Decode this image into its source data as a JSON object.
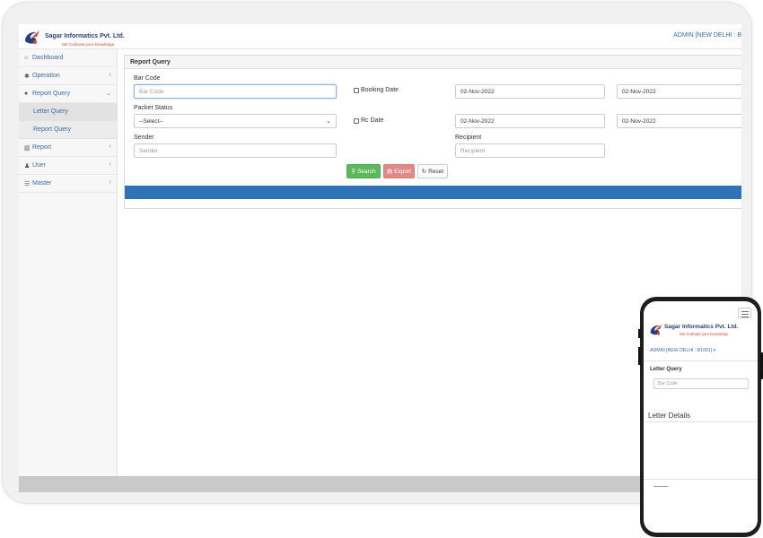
{
  "app": {
    "company_name": "Sagar Informatics Pvt. Ltd.",
    "tagline": "We Cultivate your knowledge",
    "user_label": "ADMIN [NEW DELHI : B"
  },
  "colors": {
    "primary_blue": "#2f72b6",
    "search_green": "#5cb85c",
    "export_red": "#e08a87",
    "link_blue": "#3b69a6",
    "logo_orange": "#e2452a"
  },
  "sidebar": {
    "items": [
      {
        "label": "Dashboard",
        "icon": "dashboard-icon"
      },
      {
        "label": "Operation",
        "icon": "gear-icon"
      },
      {
        "label": "Report Query",
        "icon": "question-circle-icon"
      },
      {
        "label": "Report",
        "icon": "bar-chart-icon"
      },
      {
        "label": "User",
        "icon": "user-icon"
      },
      {
        "label": "Master",
        "icon": "list-icon"
      }
    ],
    "subitems": [
      {
        "label": "Letter Query"
      },
      {
        "label": "Report Query"
      }
    ]
  },
  "form": {
    "title": "Report Query",
    "barcode_label": "Bar Code",
    "barcode_placeholder": "Bar Code",
    "packet_status_label": "Packet Status",
    "packet_status_selected": "--Select--",
    "booking_date_label": "Booking Date",
    "rc_date_label": "Rc Date",
    "booking_from": "02-Nov-2022",
    "booking_to": "02-Nov-2022",
    "rc_from": "02-Nov-2022",
    "rc_to": "02-Nov-2022",
    "sender_label": "Sender",
    "sender_placeholder": "Sender",
    "recipient_label": "Recipient",
    "recipient_placeholder": "Recipient",
    "search_label": "Search",
    "export_label": "Export",
    "reset_label": "Reset"
  },
  "phone": {
    "company_name": "Sagar Informatics Pvt. Ltd.",
    "tagline": "We Cultivate your knowledge",
    "user_label": "ADMIN [NEW DELHI : B1001] ▾",
    "section_title": "Letter Query",
    "barcode_placeholder": "Bar Code",
    "details_title": "Letter Details"
  }
}
